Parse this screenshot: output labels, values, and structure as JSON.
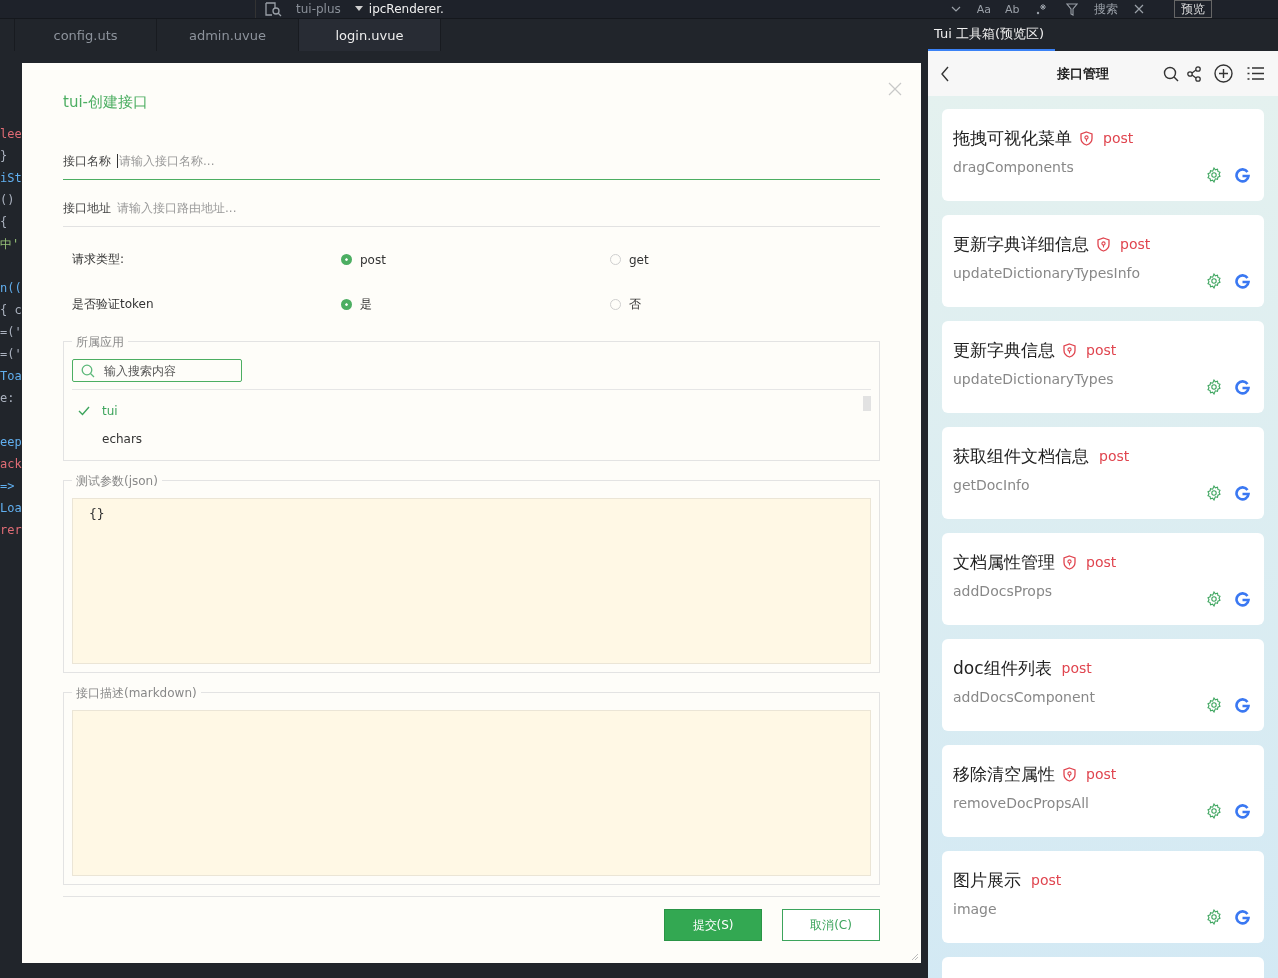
{
  "topbar": {
    "project": "tui-plus",
    "search_value": "ipcRenderer.",
    "toggles": [
      "Aa",
      "Ab"
    ],
    "search_button": "搜索",
    "preview_button": "预览"
  },
  "tabs": [
    {
      "label": "config.uts",
      "selected": false
    },
    {
      "label": "admin.uvue",
      "selected": false
    },
    {
      "label": "login.uvue",
      "selected": true
    }
  ],
  "editor_blocks": [
    [
      {
        "text": "lee",
        "color": "#e06c75"
      },
      {
        "text": "}",
        "color": "#abb2bf"
      },
      {
        "text": "iSt",
        "color": "#61afef"
      },
      {
        "text": "()",
        "color": "#abb2bf"
      },
      {
        "text": "{",
        "color": "#abb2bf"
      },
      {
        "text": "中'",
        "color": "#98c379"
      }
    ],
    [
      {
        "text": "n((",
        "color": "#61afef"
      },
      {
        "text": "{ c",
        "color": "#abb2bf"
      },
      {
        "text": "=('",
        "color": "#abb2bf"
      },
      {
        "text": "=('",
        "color": "#abb2bf"
      },
      {
        "text": "Toa",
        "color": "#61afef"
      },
      {
        "text": "e:",
        "color": "#abb2bf"
      }
    ],
    [
      {
        "text": "eep",
        "color": "#61afef"
      },
      {
        "text": "ack",
        "color": "#e06c75"
      },
      {
        "text": "=>",
        "color": "#61afef"
      },
      {
        "text": "Loa",
        "color": "#61afef"
      },
      {
        "text": "rer",
        "color": "#e06c75"
      }
    ]
  ],
  "dialog": {
    "title": "tui-创建接口",
    "fields": [
      {
        "label": "接口名称",
        "placeholder": "请输入接口名称...",
        "focused": true
      },
      {
        "label": "接口地址",
        "placeholder": "请输入接口路由地址...",
        "focused": false
      }
    ],
    "radio_groups": [
      {
        "label": "请求类型:",
        "options": [
          {
            "label": "post",
            "selected": true
          },
          {
            "label": "get",
            "selected": false
          }
        ]
      },
      {
        "label": "是否验证token",
        "options": [
          {
            "label": "是",
            "selected": true
          },
          {
            "label": "否",
            "selected": false
          }
        ]
      }
    ],
    "app_picker": {
      "legend": "所属应用",
      "search_placeholder": "输入搜索内容",
      "items": [
        {
          "label": "tui",
          "checked": true
        },
        {
          "label": "echars",
          "checked": false
        }
      ]
    },
    "params": {
      "legend": "测试参数(json)",
      "value": "{}"
    },
    "description": {
      "legend": "接口描述(markdown)"
    },
    "buttons": [
      {
        "label": "提交(S)",
        "kind": "primary"
      },
      {
        "label": "取消(C)",
        "kind": "secondary"
      }
    ]
  },
  "preview": {
    "tab": "Tui 工具箱(预览区)",
    "title": "接口管理",
    "cards": [
      {
        "title": "拖拽可视化菜单",
        "secured": true,
        "method": "post",
        "name": "dragComponents"
      },
      {
        "title": "更新字典详细信息",
        "secured": true,
        "method": "post",
        "name": "updateDictionaryTypesInfo"
      },
      {
        "title": "更新字典信息",
        "secured": true,
        "method": "post",
        "name": "updateDictionaryTypes"
      },
      {
        "title": "获取组件文档信息",
        "secured": false,
        "method": "post",
        "name": "getDocInfo"
      },
      {
        "title": "文档属性管理",
        "secured": true,
        "method": "post",
        "name": "addDocsProps"
      },
      {
        "title": "doc组件列表",
        "secured": false,
        "method": "post",
        "name": "addDocsComponent"
      },
      {
        "title": "移除清空属性",
        "secured": true,
        "method": "post",
        "name": "removeDocPropsAll"
      },
      {
        "title": "图片展示",
        "secured": false,
        "method": "post",
        "name": "image"
      }
    ]
  }
}
